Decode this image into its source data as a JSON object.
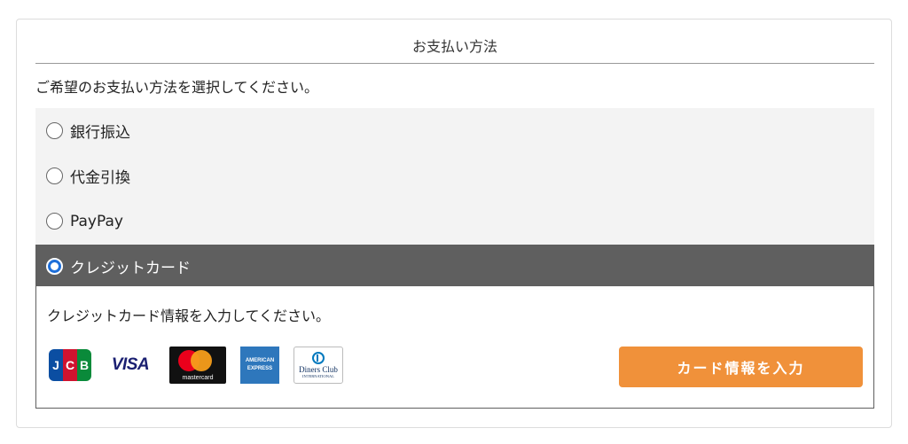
{
  "payment": {
    "title": "お支払い方法",
    "instruction": "ご希望のお支払い方法を選択してください。",
    "options": [
      {
        "label": "銀行振込",
        "selected": false
      },
      {
        "label": "代金引換",
        "selected": false
      },
      {
        "label": "PayPay",
        "selected": false
      },
      {
        "label": "クレジットカード",
        "selected": true
      }
    ]
  },
  "credit": {
    "prompt": "クレジットカード情報を入力してください。",
    "button_label": "カード情報を入力",
    "logos": {
      "jcb": [
        "J",
        "C",
        "B"
      ],
      "visa": "VISA",
      "mastercard": "mastercard",
      "amex": [
        "AMERICAN",
        "EXPRESS"
      ],
      "diners": [
        "Diners Club",
        "INTERNATIONAL"
      ]
    }
  },
  "colors": {
    "accent_button": "#f0913a",
    "selected_row": "#5f5f5f",
    "options_bg": "#f3f3f3",
    "radio_selected": "#1e6fd9"
  }
}
